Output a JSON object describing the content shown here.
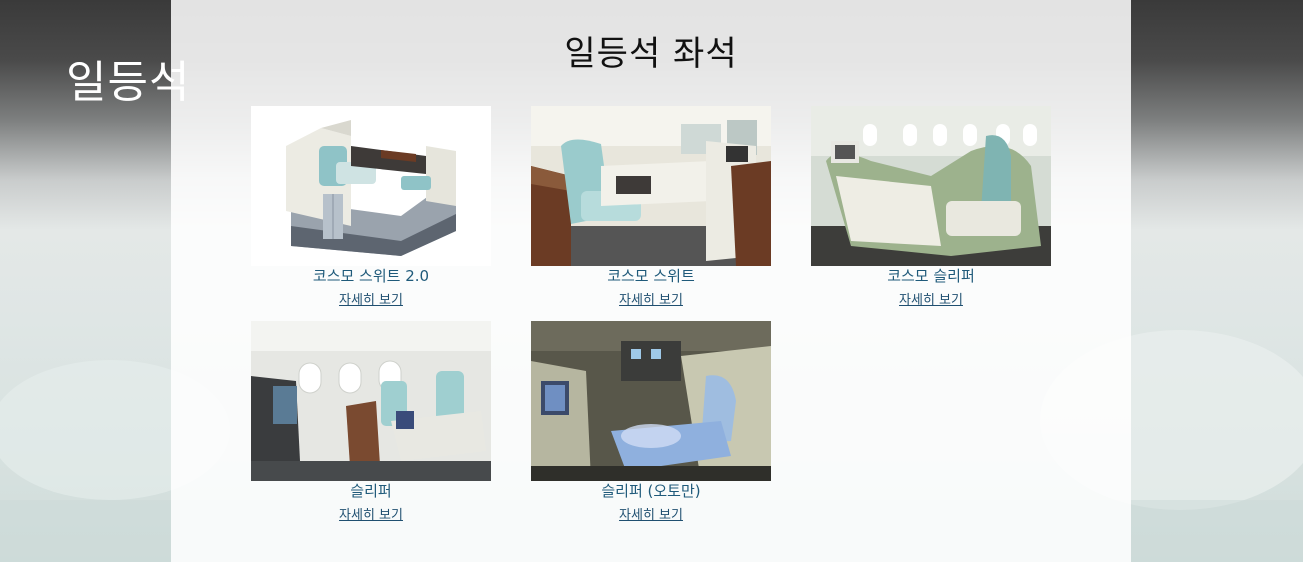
{
  "hero": {
    "title": "일등석"
  },
  "section": {
    "title": "일등석 좌석"
  },
  "cards": [
    {
      "name": "코스모 스위트 2.0",
      "link": "자세히 보기"
    },
    {
      "name": "코스모 스위트",
      "link": "자세히 보기"
    },
    {
      "name": "코스모 슬리퍼",
      "link": "자세히 보기"
    },
    {
      "name": "슬리퍼",
      "link": "자세히 보기"
    },
    {
      "name": "슬리퍼 (오토만)",
      "link": "자세히 보기"
    }
  ],
  "colors": {
    "seat_teal": "#8fc3c7",
    "cabin_cream": "#ece9dc",
    "wood": "#6b3b24",
    "link": "#1f4f70"
  }
}
